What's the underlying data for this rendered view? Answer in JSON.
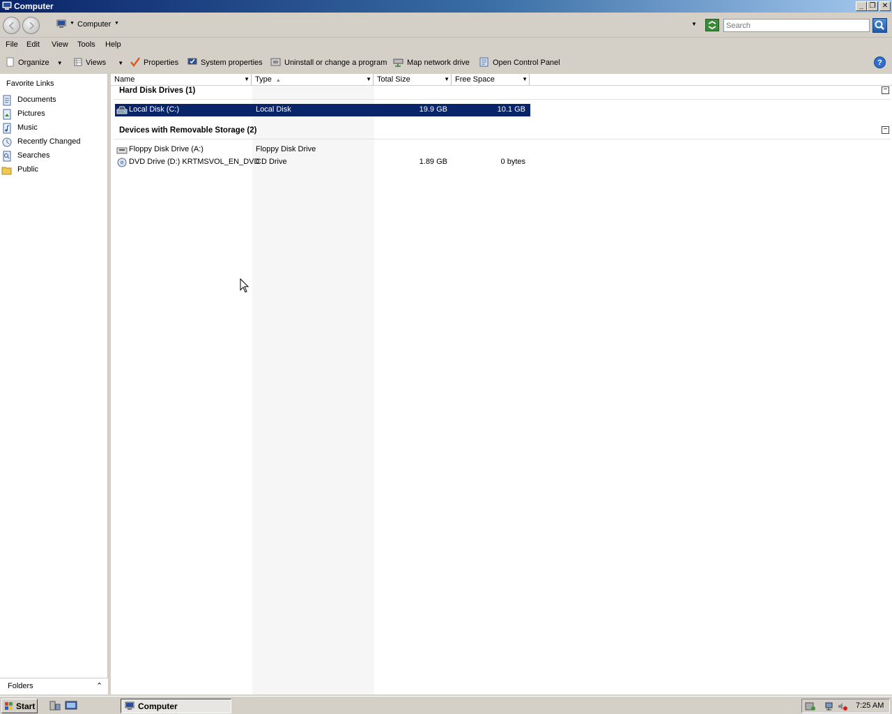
{
  "window": {
    "title": "Computer"
  },
  "address": {
    "location": "Computer",
    "search_placeholder": "Search"
  },
  "menu": [
    "File",
    "Edit",
    "View",
    "Tools",
    "Help"
  ],
  "commands": {
    "organize": "Organize",
    "views": "Views",
    "properties": "Properties",
    "system_properties": "System properties",
    "uninstall": "Uninstall or change a program",
    "map_drive": "Map network drive",
    "control_panel": "Open Control Panel",
    "help_label": "?"
  },
  "nav": {
    "favorite_links_header": "Favorite Links",
    "items": [
      {
        "label": "Documents",
        "icon": "documents-icon"
      },
      {
        "label": "Pictures",
        "icon": "pictures-icon"
      },
      {
        "label": "Music",
        "icon": "music-icon"
      },
      {
        "label": "Recently Changed",
        "icon": "recent-icon"
      },
      {
        "label": "Searches",
        "icon": "searches-icon"
      },
      {
        "label": "Public",
        "icon": "folder-icon"
      }
    ],
    "folders_label": "Folders"
  },
  "columns": {
    "name": "Name",
    "type": "Type",
    "total_size": "Total Size",
    "free_space": "Free Space"
  },
  "groups": [
    {
      "title": "Hard Disk Drives (1)",
      "rows": [
        {
          "name": "Local Disk (C:)",
          "type": "Local Disk",
          "total_size": "19.9 GB",
          "free_space": "10.1 GB",
          "selected": true,
          "icon": "hard-disk-icon"
        }
      ]
    },
    {
      "title": "Devices with Removable Storage (2)",
      "rows": [
        {
          "name": "Floppy Disk Drive (A:)",
          "type": "Floppy Disk Drive",
          "total_size": "",
          "free_space": "",
          "selected": false,
          "icon": "floppy-drive-icon"
        },
        {
          "name": "DVD Drive (D:) KRTMSVOL_EN_DVD",
          "type": "CD Drive",
          "total_size": "1.89 GB",
          "free_space": "0 bytes",
          "selected": false,
          "icon": "dvd-drive-icon"
        }
      ]
    }
  ],
  "taskbar": {
    "start_label": "Start",
    "task_label": "Computer",
    "clock": "7:25 AM"
  },
  "colors": {
    "selection": "#0a246a",
    "title_start": "#0a246a",
    "title_end": "#a6caf0"
  }
}
